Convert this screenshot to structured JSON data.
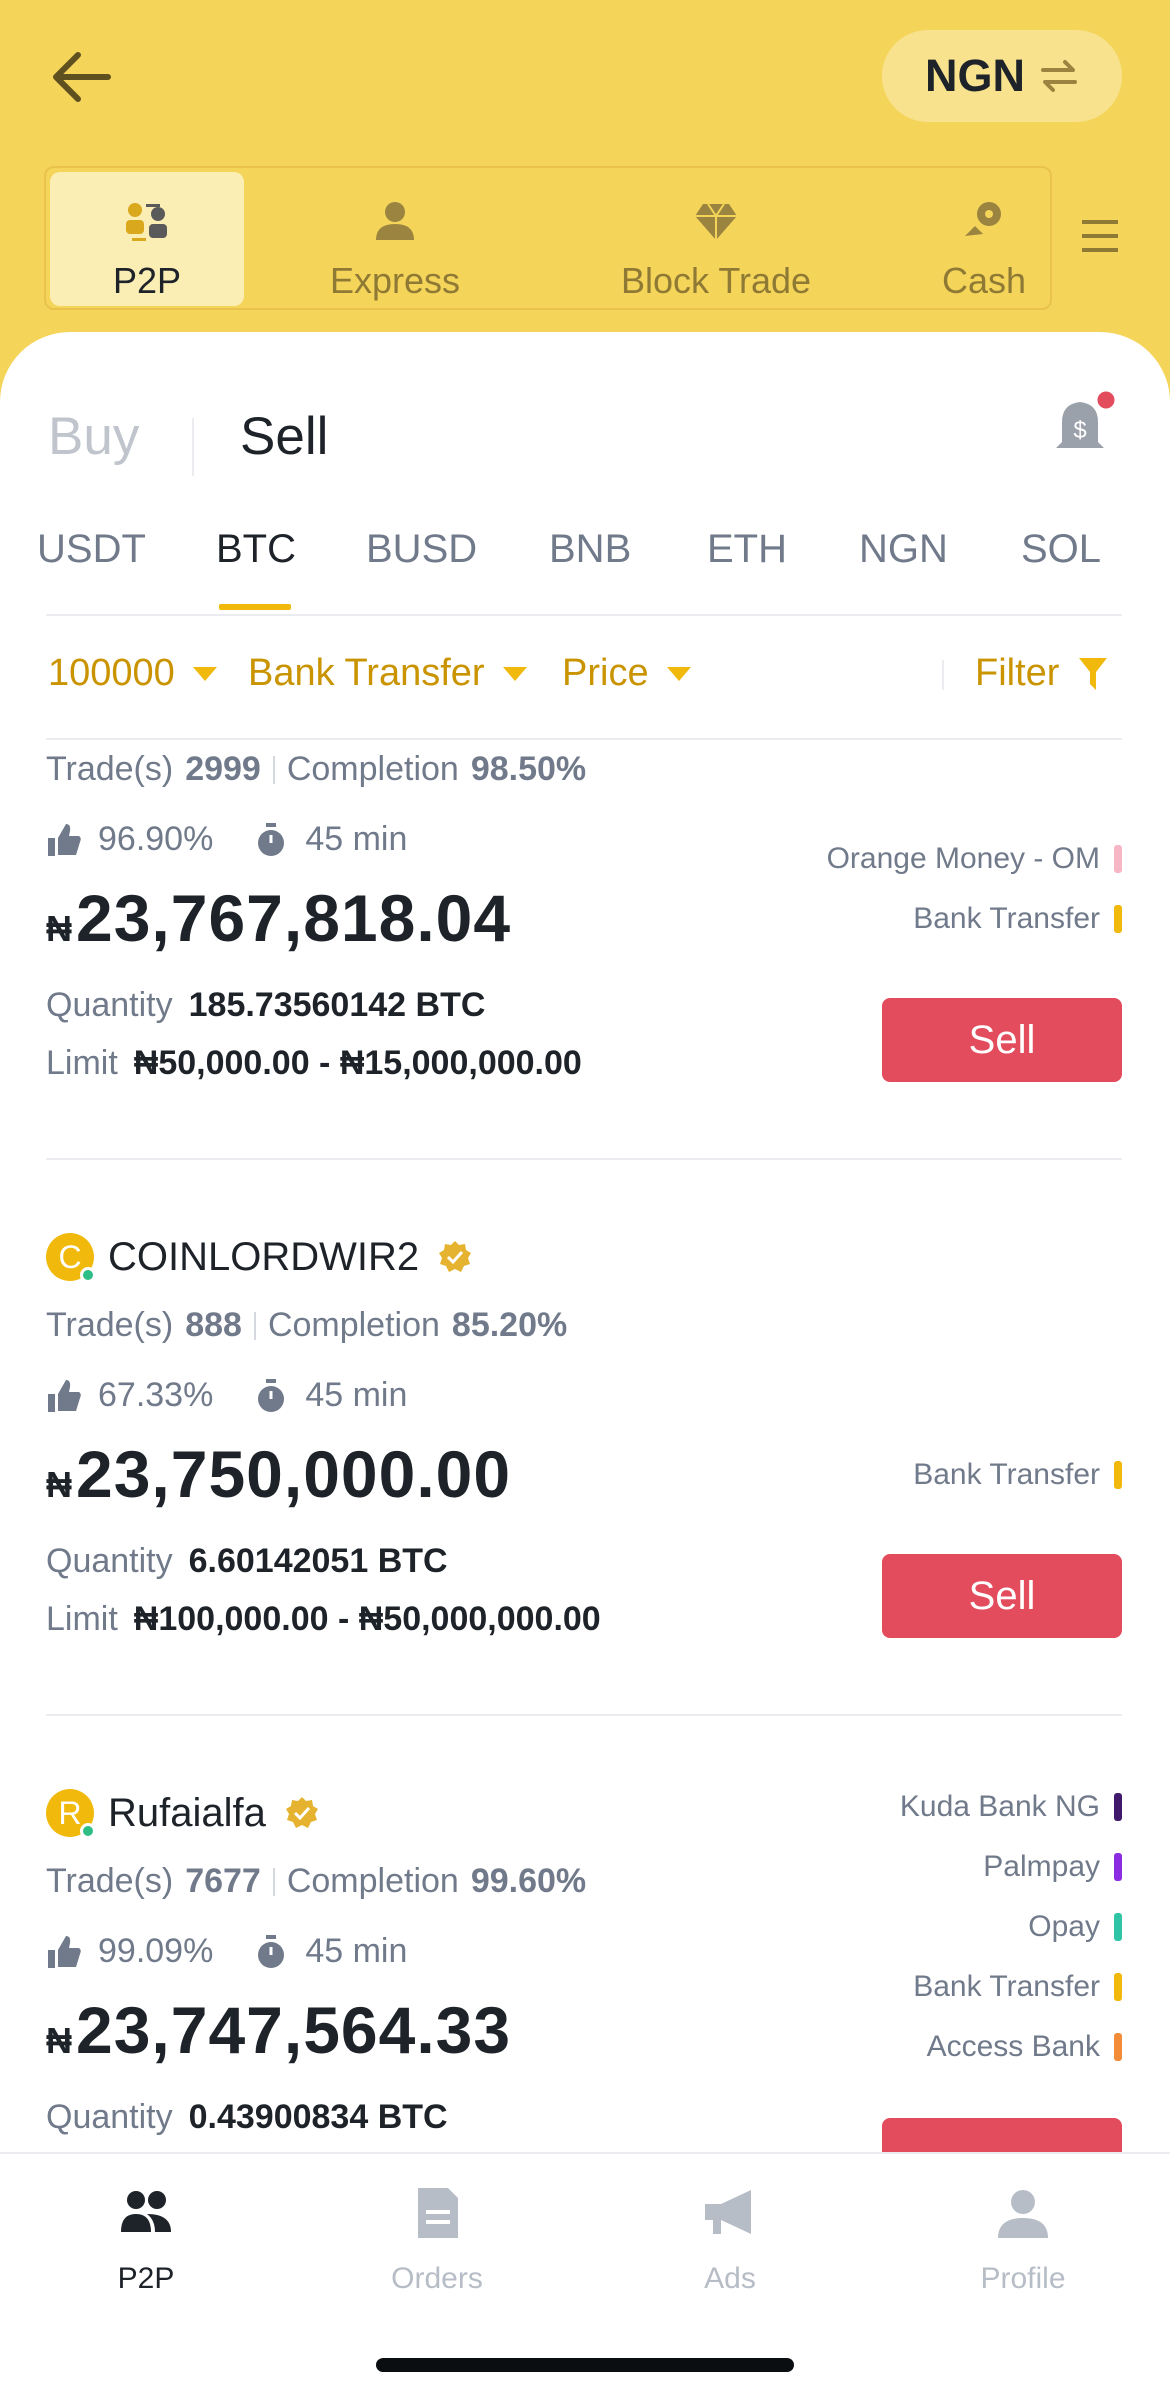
{
  "header": {
    "currency": "NGN",
    "modes": [
      {
        "label": "P2P",
        "icon": "p2p-icon",
        "active": true
      },
      {
        "label": "Express",
        "icon": "express-icon",
        "active": false
      },
      {
        "label": "Block Trade",
        "icon": "diamond-icon",
        "active": false
      },
      {
        "label": "Cash",
        "icon": "cash-icon",
        "active": false
      }
    ]
  },
  "trade_side": {
    "buy": "Buy",
    "sell": "Sell",
    "active": "Sell"
  },
  "assets": [
    "USDT",
    "BTC",
    "BUSD",
    "BNB",
    "ETH",
    "NGN",
    "SOL"
  ],
  "active_asset": "BTC",
  "filters": {
    "amount": "100000",
    "payment": "Bank Transfer",
    "sort": "Price",
    "filter": "Filter"
  },
  "ads": [
    {
      "name": "",
      "trades_label": "Trade(s)",
      "trades": "2999",
      "completion_label": "Completion",
      "completion": "98.50%",
      "rating": "96.90%",
      "time": "45 min",
      "currency_symbol": "₦",
      "price": "23,767,818.04",
      "quantity_label": "Quantity",
      "quantity": "185.73560142 BTC",
      "limit_label": "Limit",
      "limit": "₦50,000.00 - ₦15,000,000.00",
      "payments": [
        {
          "name": "Orange Money - OM",
          "color": "#f7b6c6"
        },
        {
          "name": "Bank Transfer",
          "color": "#f0b90b"
        }
      ],
      "action": "Sell"
    },
    {
      "name": "COINLORDWIR2",
      "avatar": "C",
      "trades_label": "Trade(s)",
      "trades": "888",
      "completion_label": "Completion",
      "completion": "85.20%",
      "rating": "67.33%",
      "time": "45 min",
      "currency_symbol": "₦",
      "price": "23,750,000.00",
      "quantity_label": "Quantity",
      "quantity": "6.60142051 BTC",
      "limit_label": "Limit",
      "limit": "₦100,000.00 - ₦50,000,000.00",
      "payments": [
        {
          "name": "Bank Transfer",
          "color": "#f0b90b"
        }
      ],
      "action": "Sell"
    },
    {
      "name": "Rufaialfa",
      "avatar": "R",
      "trades_label": "Trade(s)",
      "trades": "7677",
      "completion_label": "Completion",
      "completion": "99.60%",
      "rating": "99.09%",
      "time": "45 min",
      "currency_symbol": "₦",
      "price": "23,747,564.33",
      "quantity_label": "Quantity",
      "quantity": "0.43900834 BTC",
      "payments": [
        {
          "name": "Kuda Bank NG",
          "color": "#40196d"
        },
        {
          "name": "Palmpay",
          "color": "#8b2be2"
        },
        {
          "name": "Opay",
          "color": "#2ec4a5"
        },
        {
          "name": "Bank Transfer",
          "color": "#f0b90b"
        },
        {
          "name": "Access Bank",
          "color": "#f28c38"
        }
      ]
    }
  ],
  "bottom_nav": [
    {
      "label": "P2P",
      "icon": "p2p-nav-icon",
      "active": true
    },
    {
      "label": "Orders",
      "icon": "orders-icon",
      "active": false
    },
    {
      "label": "Ads",
      "icon": "megaphone-icon",
      "active": false
    },
    {
      "label": "Profile",
      "icon": "profile-icon",
      "active": false
    }
  ]
}
